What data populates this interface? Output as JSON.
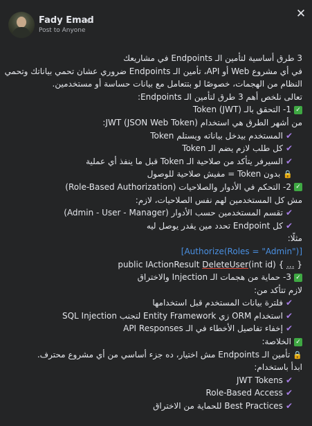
{
  "post": {
    "author": "Fady Emad",
    "privacy": "Post to Anyone"
  },
  "lines": {
    "l1": "3 طرق أساسية لتأمين الـ Endpoints في مشاريعك",
    "l2": "في أي مشروع Web أو API، تأمين الـ Endpoints ضروري عشان تحمي بياناتك وتحمي",
    "l3": "النظام من الهجمات، خصوصًا لو بتتعامل مع بيانات حساسة أو مستخدمين.",
    "l4": "تعالى نلخص أهم 3 طرق لتأمين الـ Endpoints:",
    "l5": "1- التحقق بالـ Token (JWT)",
    "l6": "من أشهر الطرق هي استخدام JWT (JSON Web Token):",
    "l7": "المستخدم بيدخل بياناته ويستلم Token",
    "l8": "كل طلب لازم يضم الـ Token",
    "l9": "السيرفر يتأكد من صلاحية الـ Token قبل ما ينفذ أي عملية",
    "l10": "بدون Token = مفيش صلاحية للوصول",
    "l11": "2- التحكم في الأدوار والصلاحيات (Role-Based Authorization)",
    "l12": "مش كل المستخدمين لهم نفس الصلاحيات، لازم:",
    "l13": "تقسم المستخدمين حسب الأدوار (Admin - User - Manager)",
    "l14": "كل Endpoint تحدد مين يقدر يوصل ليه",
    "l15": "مثلًا:",
    "l16": "[Authorize(Roles = \"Admin\")]",
    "l17a": "public IActionResult ",
    "l17b": "DeleteUser",
    "l17c": "(int id) { ",
    "l17d": "...",
    "l17e": " }",
    "l18": "3- حماية من هجمات الـ Injection والاختراق",
    "l19": "لازم تتأكد من:",
    "l20": "فلترة بيانات المستخدم قبل استخدامها",
    "l21": "استخدام ORM زي Entity Framework لتجنب SQL Injection",
    "l22": "إخفاء تفاصيل الأخطاء في الـ API Responses",
    "l23": "الخلاصة:",
    "l24": "تأمين الـ Endpoints مش اختيار، ده جزء أساسي من أي مشروع محترف.",
    "l25": "ابدأ باستخدام:",
    "l26": "JWT Tokens",
    "l27": "Role-Based Access",
    "l28": "Best Practices للحماية من الاختراق"
  },
  "icons": {
    "check_color": "#3fa843",
    "tick_color": "#a77de5",
    "lock_color": "#e0a13a",
    "code_color": "#4a90e2"
  }
}
